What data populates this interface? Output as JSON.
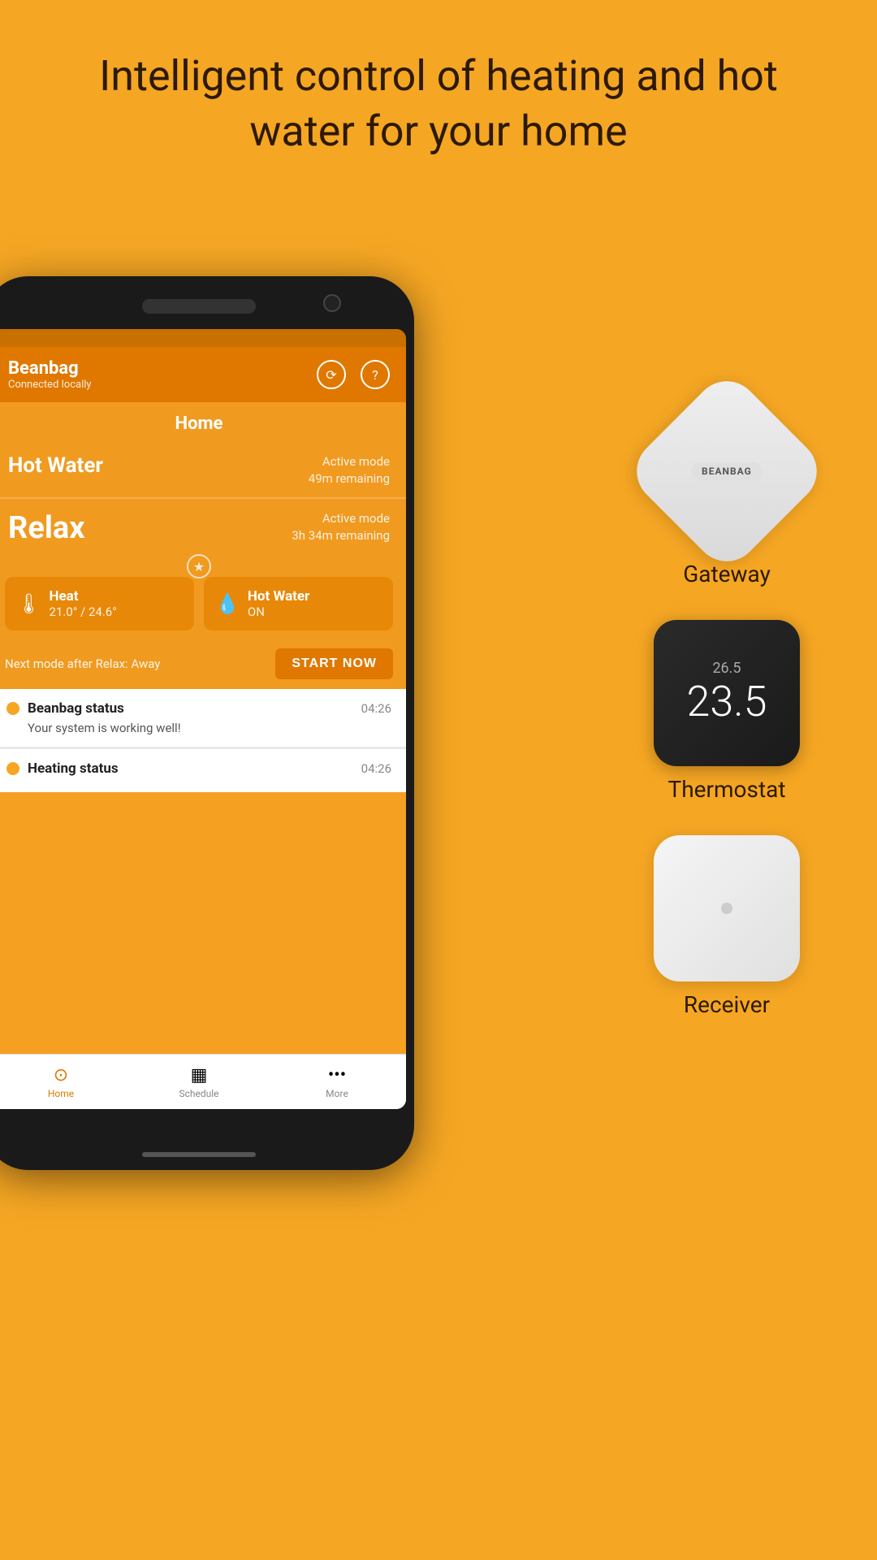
{
  "headline": "Intelligent control of heating and hot water for your home",
  "brand": {
    "name": "Beanbag",
    "status": "Connected locally"
  },
  "toolbar": {
    "home_icon": "⟳",
    "help_icon": "?"
  },
  "app": {
    "section_title": "Home",
    "hot_water_label": "Hot Water",
    "hot_water_mode": "Active mode",
    "hot_water_remaining": "49m remaining",
    "relax_label": "Relax",
    "relax_mode": "Active mode",
    "relax_remaining": "3h 34m remaining",
    "heat_card_title": "Heat",
    "heat_card_value": "21.0° / 24.6°",
    "hot_water_card_title": "Hot Water",
    "hot_water_card_value": "ON",
    "next_mode_text": "Next mode after Relax: Away",
    "start_now_label": "START NOW"
  },
  "status_cards": [
    {
      "title": "Beanbag status",
      "time": "04:26",
      "body": "Your system is working well!"
    },
    {
      "title": "Heating status",
      "time": "04:26",
      "body": ""
    }
  ],
  "bottom_nav": [
    {
      "label": "Home",
      "icon": "⊙",
      "active": true
    },
    {
      "label": "Schedule",
      "icon": "▦",
      "active": false
    },
    {
      "label": "More",
      "icon": "•••",
      "active": false
    }
  ],
  "devices": [
    {
      "name": "Gateway",
      "inner_label": "BEANBAG"
    },
    {
      "name": "Thermostat",
      "temp_small": "26.5",
      "temp_large": "23.5"
    },
    {
      "name": "Receiver"
    }
  ],
  "colors": {
    "orange": "#F5A623",
    "dark_orange": "#e07800",
    "app_orange": "#f09a20"
  }
}
